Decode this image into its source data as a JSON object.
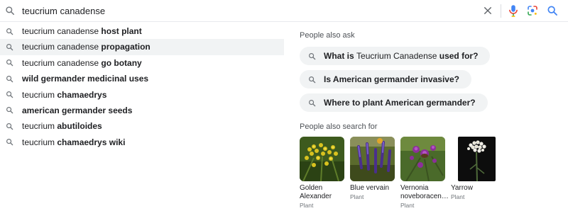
{
  "search": {
    "query": "teucrium canadense",
    "clear_icon": "close-icon",
    "mic_icon": "microphone-icon",
    "lens_icon": "camera-lens-icon",
    "search_icon": "search-icon"
  },
  "suggestions": [
    {
      "prefix": "teucrium canadense ",
      "bold": "host plant",
      "rest": ""
    },
    {
      "prefix": "teucrium canadense ",
      "bold": "propagation",
      "rest": ""
    },
    {
      "prefix": "teucrium canadense ",
      "bold": "go botany",
      "rest": ""
    },
    {
      "prefix": "",
      "bold": "wild germander medicinal uses",
      "rest": ""
    },
    {
      "prefix": "teucrium ",
      "bold": "chamaedrys",
      "rest": ""
    },
    {
      "prefix": "",
      "bold": "american germander seeds",
      "rest": ""
    },
    {
      "prefix": "teucrium ",
      "bold": "abutiloides",
      "rest": ""
    },
    {
      "prefix": "teucrium ",
      "bold": "chamaedrys wiki",
      "rest": ""
    }
  ],
  "people_also_ask": {
    "label": "People also ask",
    "questions": [
      {
        "a": "What is ",
        "b": "Teucrium Canadense",
        "c": " used for?"
      },
      {
        "a": "Is American germander invasive?",
        "b": "",
        "c": ""
      },
      {
        "a": "Where to plant American germander?",
        "b": "",
        "c": ""
      }
    ]
  },
  "people_also_search": {
    "label": "People also search for",
    "items": [
      {
        "title": "Golden Alexander",
        "subtitle": "Plant"
      },
      {
        "title": "Blue vervain",
        "subtitle": "Plant"
      },
      {
        "title": "Vernonia noveboracen…",
        "subtitle": "Plant"
      },
      {
        "title": "Yarrow",
        "subtitle": "Plant"
      }
    ]
  },
  "colors": {
    "highlight_row": "#f1f3f4",
    "chip_bg": "#f1f3f4",
    "submit_blue": "#4285f4"
  }
}
